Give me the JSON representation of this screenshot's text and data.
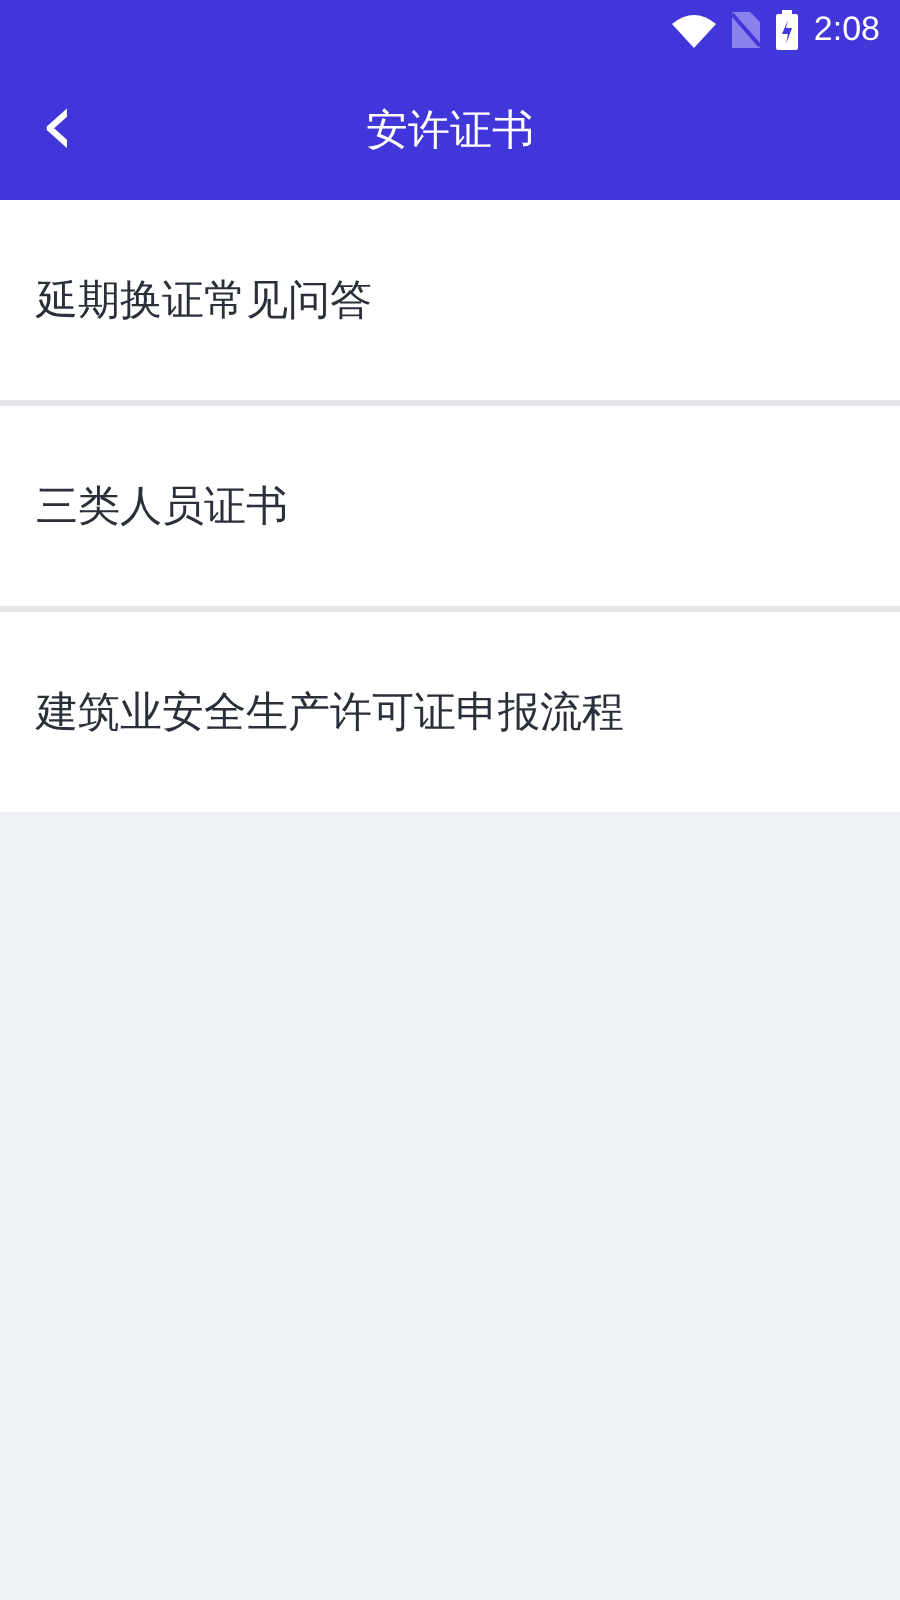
{
  "status_bar": {
    "time": "2:08"
  },
  "header": {
    "back": "‹",
    "title": "安许证书"
  },
  "items": [
    {
      "label": "延期换证常见问答"
    },
    {
      "label": "三类人员证书"
    },
    {
      "label": "建筑业安全生产许可证申报流程"
    }
  ]
}
